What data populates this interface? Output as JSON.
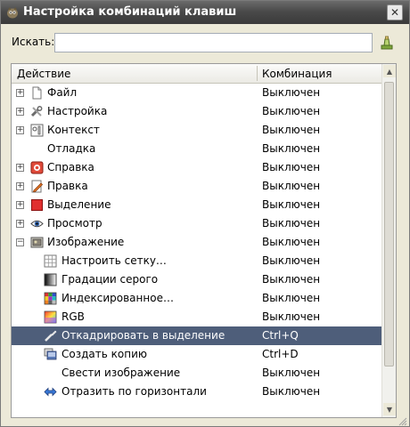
{
  "window": {
    "title": "Настройка комбинаций клавиш"
  },
  "search": {
    "label": "Искать:",
    "value": "",
    "placeholder": ""
  },
  "columns": {
    "action": "Действие",
    "combination": "Комбинация"
  },
  "rows": [
    {
      "label": "Файл",
      "combo": "Выключен",
      "expander": "plus",
      "indent": 0,
      "icon": "file-icon"
    },
    {
      "label": "Настройка",
      "combo": "Выключен",
      "expander": "plus",
      "indent": 0,
      "icon": "tools-icon"
    },
    {
      "label": "Контекст",
      "combo": "Выключен",
      "expander": "plus",
      "indent": 0,
      "icon": "context-icon"
    },
    {
      "label": "Отладка",
      "combo": "Выключен",
      "expander": "none",
      "indent": 0,
      "icon": ""
    },
    {
      "label": "Справка",
      "combo": "Выключен",
      "expander": "plus",
      "indent": 0,
      "icon": "help-icon"
    },
    {
      "label": "Правка",
      "combo": "Выключен",
      "expander": "plus",
      "indent": 0,
      "icon": "edit-icon"
    },
    {
      "label": "Выделение",
      "combo": "Выключен",
      "expander": "plus",
      "indent": 0,
      "icon": "selection-icon"
    },
    {
      "label": "Просмотр",
      "combo": "Выключен",
      "expander": "plus",
      "indent": 0,
      "icon": "view-icon"
    },
    {
      "label": "Изображение",
      "combo": "Выключен",
      "expander": "minus",
      "indent": 0,
      "icon": "image-icon"
    },
    {
      "label": "Настроить сетку…",
      "combo": "Выключен",
      "expander": "none",
      "indent": 1,
      "icon": "grid-icon"
    },
    {
      "label": "Градации серого",
      "combo": "Выключен",
      "expander": "none",
      "indent": 1,
      "icon": "grayscale-icon"
    },
    {
      "label": "Индексированное…",
      "combo": "Выключен",
      "expander": "none",
      "indent": 1,
      "icon": "indexed-icon"
    },
    {
      "label": "RGB",
      "combo": "Выключен",
      "expander": "none",
      "indent": 1,
      "icon": "rgb-icon"
    },
    {
      "label": "Откадрировать в выделение",
      "combo": "Ctrl+Q",
      "expander": "none",
      "indent": 1,
      "icon": "crop-icon",
      "selected": true
    },
    {
      "label": "Создать копию",
      "combo": "Ctrl+D",
      "expander": "none",
      "indent": 1,
      "icon": "duplicate-icon"
    },
    {
      "label": "Свести изображение",
      "combo": "Выключен",
      "expander": "none",
      "indent": 1,
      "icon": ""
    },
    {
      "label": "Отразить по горизонтали",
      "combo": "Выключен",
      "expander": "none",
      "indent": 1,
      "icon": "flip-horizontal-icon"
    }
  ]
}
